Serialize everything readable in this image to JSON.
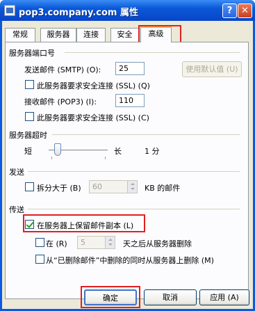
{
  "window": {
    "title": "pop3.company.com 属性",
    "help": "?",
    "close": "✕"
  },
  "tabs": [
    "常规",
    "服务器",
    "连接",
    "安全",
    "高级"
  ],
  "ports": {
    "group": "服务器端口号",
    "smtp_label": "发送邮件 (SMTP) (O):",
    "smtp_value": "25",
    "default_button": "使用默认值 (U)",
    "smtp_ssl": "此服务器要求安全连接 (SSL) (Q)",
    "pop3_label": "接收邮件 (POP3) (I):",
    "pop3_value": "110",
    "pop3_ssl": "此服务器要求安全连接 (SSL) (C)"
  },
  "timeout": {
    "group": "服务器超时",
    "short": "短",
    "long": "长",
    "value": "1 分",
    "level": 0.1
  },
  "sending": {
    "group": "发送",
    "split_label": "拆分大于 (B)",
    "split_value": "60",
    "split_unit": "KB 的邮件"
  },
  "delivery": {
    "group": "传送",
    "leave_copy": "在服务器上保留邮件副本 (L)",
    "remove_after_label": "在 (R)",
    "remove_after_value": "5",
    "remove_after_unit": "天之后从服务器删除",
    "remove_deleted": "从“已删除邮件”中删除的同时从服务器上删除 (M)"
  },
  "buttons": {
    "ok": "确定",
    "cancel": "取消",
    "apply": "应用 (A)"
  }
}
